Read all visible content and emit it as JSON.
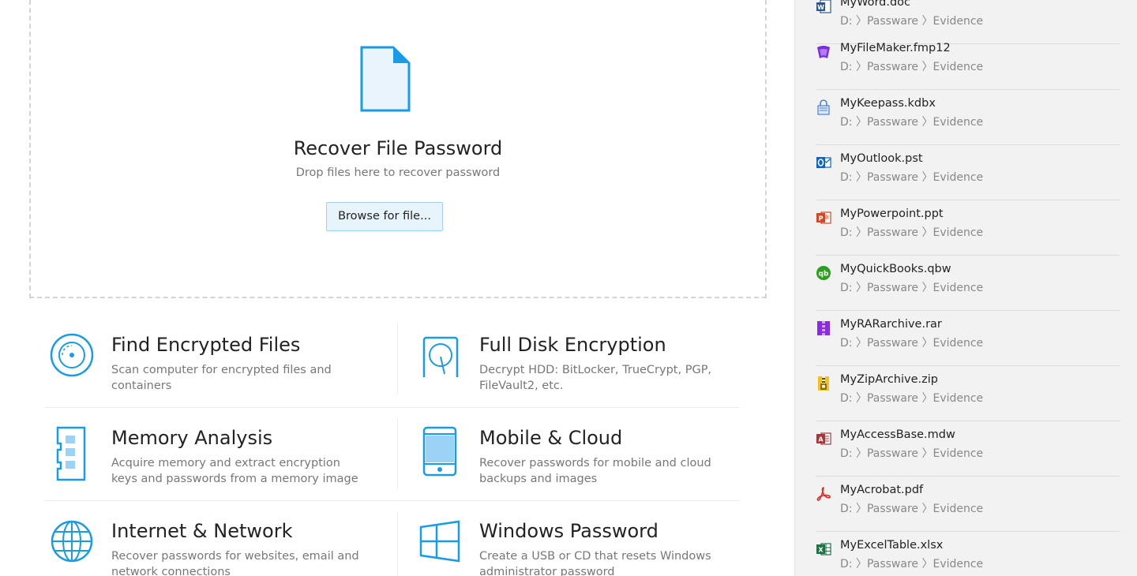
{
  "drop_zone": {
    "title": "Recover File Password",
    "subtitle": "Drop files here to recover password",
    "browse_label": "Browse for file..."
  },
  "features": [
    {
      "title": "Find Encrypted Files",
      "desc": "Scan computer for encrypted files and containers",
      "icon": "disc-icon"
    },
    {
      "title": "Full Disk Encryption",
      "desc": "Decrypt HDD: BitLocker, TrueCrypt, PGP, FileVault2, etc.",
      "icon": "hard-disk-icon"
    },
    {
      "title": "Memory Analysis",
      "desc": "Acquire memory and extract encryption keys and passwords from a memory image",
      "icon": "memory-stick-icon"
    },
    {
      "title": "Mobile & Cloud",
      "desc": "Recover passwords for mobile and cloud backups and images",
      "icon": "mobile-phone-icon"
    },
    {
      "title": "Internet & Network",
      "desc": "Recover passwords for websites, email and network connections",
      "icon": "globe-icon"
    },
    {
      "title": "Windows Password",
      "desc": "Create a USB or CD that resets Windows administrator password",
      "icon": "windows-logo-icon"
    }
  ],
  "recent_files": [
    {
      "name": "MyWord.doc",
      "path": "D: 〉Passware 〉Evidence",
      "icon": "word-icon",
      "color": "#2b579a"
    },
    {
      "name": "MyFileMaker.fmp12",
      "path": "D: 〉Passware 〉Evidence",
      "icon": "filemaker-icon",
      "color": "#7b2ee0"
    },
    {
      "name": "MyKeepass.kdbx",
      "path": "D: 〉Passware 〉Evidence",
      "icon": "keepass-icon",
      "color": "#4a7fd4"
    },
    {
      "name": "MyOutlook.pst",
      "path": "D: 〉Passware 〉Evidence",
      "icon": "outlook-icon",
      "color": "#0a64c8"
    },
    {
      "name": "MyPowerpoint.ppt",
      "path": "D: 〉Passware 〉Evidence",
      "icon": "powerpoint-icon",
      "color": "#d24726"
    },
    {
      "name": "MyQuickBooks.qbw",
      "path": "D: 〉Passware 〉Evidence",
      "icon": "quickbooks-icon",
      "color": "#2ca01c"
    },
    {
      "name": "MyRARarchive.rar",
      "path": "D: 〉Passware 〉Evidence",
      "icon": "rar-icon",
      "color": "#8a2be2"
    },
    {
      "name": "MyZipArchive.zip",
      "path": "D: 〉Passware 〉Evidence",
      "icon": "zip-icon",
      "color": "#f2c21b"
    },
    {
      "name": "MyAccessBase.mdw",
      "path": "D: 〉Passware 〉Evidence",
      "icon": "access-icon",
      "color": "#a4373a"
    },
    {
      "name": "MyAcrobat.pdf",
      "path": "D: 〉Passware 〉Evidence",
      "icon": "acrobat-icon",
      "color": "#e12a1f"
    },
    {
      "name": "MyExcelTable.xlsx",
      "path": "D: 〉Passware 〉Evidence",
      "icon": "excel-icon",
      "color": "#1e7145"
    }
  ],
  "colors": {
    "accent": "#1a9be8",
    "panel_bg": "#f2f2f2"
  }
}
